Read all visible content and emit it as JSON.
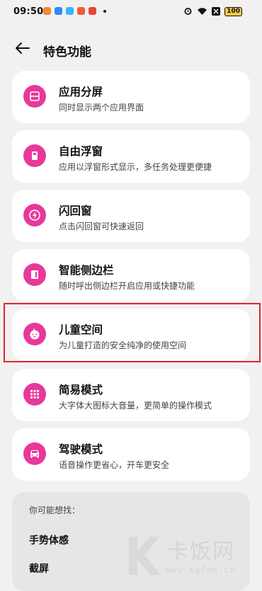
{
  "status_bar": {
    "time": "09:50",
    "battery": "100",
    "app_icon_colors": [
      "#f08a3a",
      "#2f88ff",
      "#37b3ff",
      "#f05a3a",
      "#e8452f"
    ]
  },
  "header": {
    "back_icon": "arrow-left-icon",
    "title": "特色功能"
  },
  "features": [
    {
      "title": "应用分屏",
      "subtitle": "同时显示两个应用界面",
      "icon": "split-screen-icon"
    },
    {
      "title": "自由浮窗",
      "subtitle": "应用以浮窗形式显示，多任务处理更便捷",
      "icon": "floating-window-icon"
    },
    {
      "title": "闪回窗",
      "subtitle": "点击闪回窗可快速返回",
      "icon": "flashback-icon"
    },
    {
      "title": "智能侧边栏",
      "subtitle": "随时呼出侧边栏开启应用或快捷功能",
      "icon": "sidebar-icon"
    },
    {
      "title": "儿童空间",
      "subtitle": "为儿童打造的安全纯净的使用空间",
      "icon": "kid-face-icon"
    },
    {
      "title": "简易模式",
      "subtitle": "大字体大图标大音量，更简单的操作模式",
      "icon": "grid-dots-icon"
    },
    {
      "title": "驾驶模式",
      "subtitle": "语音操作更省心，开车更安全",
      "icon": "car-icon"
    }
  ],
  "suggestions": {
    "heading": "你可能想找：",
    "items": [
      "手势体感",
      "截屏"
    ]
  },
  "watermark": {
    "text": "卡饭网",
    "url": "www.kafan.cn"
  },
  "colors": {
    "accent": "#e8389a",
    "highlight": "#e0232a",
    "background": "#f1f1f1"
  }
}
